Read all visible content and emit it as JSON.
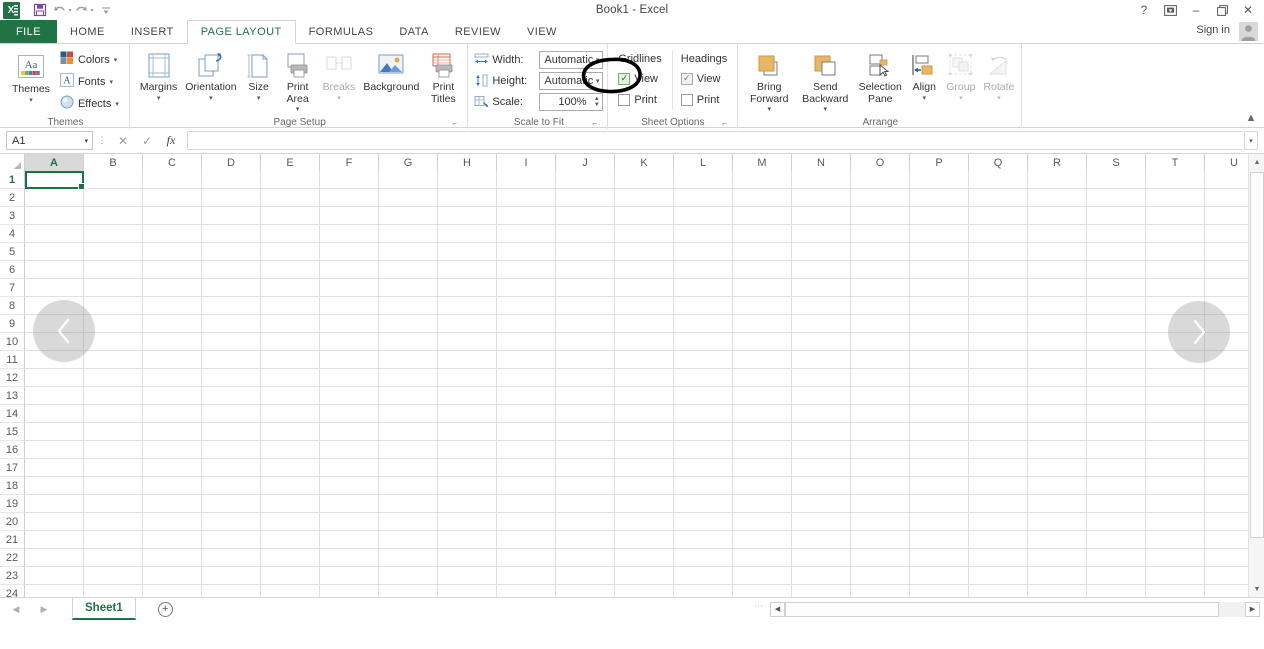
{
  "window": {
    "title": "Book1 - Excel",
    "app_icon": "excel-logo-icon",
    "controls": {
      "help": "?",
      "ribbon_display": "ribbon-display-options-icon",
      "minimize": "–",
      "restore": "❐",
      "close": "✕"
    },
    "quick_access": [
      {
        "name": "save-icon",
        "label": "Save"
      },
      {
        "name": "undo-icon",
        "label": "Undo"
      },
      {
        "name": "redo-icon",
        "label": "Redo"
      },
      {
        "name": "customize-qat-icon",
        "label": "Customize Quick Access Toolbar"
      }
    ]
  },
  "account": {
    "sign_in": "Sign in",
    "avatar": "user-avatar-icon"
  },
  "tabs": [
    {
      "label": "FILE",
      "active": false,
      "file": true
    },
    {
      "label": "HOME",
      "active": false
    },
    {
      "label": "INSERT",
      "active": false
    },
    {
      "label": "PAGE LAYOUT",
      "active": true
    },
    {
      "label": "FORMULAS",
      "active": false
    },
    {
      "label": "DATA",
      "active": false
    },
    {
      "label": "REVIEW",
      "active": false
    },
    {
      "label": "VIEW",
      "active": false
    }
  ],
  "ribbon": {
    "collapse_label": "▲",
    "groups": {
      "themes": {
        "label": "Themes",
        "main": {
          "label": "Themes",
          "caret": "▾",
          "icon": "themes-icon"
        },
        "items": [
          {
            "label": "Colors",
            "caret": "▾",
            "icon": "colors-icon"
          },
          {
            "label": "Fonts",
            "caret": "▾",
            "icon": "fonts-icon"
          },
          {
            "label": "Effects",
            "caret": "▾",
            "icon": "effects-icon"
          }
        ]
      },
      "page_setup": {
        "label": "Page Setup",
        "items": [
          {
            "label": "Margins",
            "caret": "▾",
            "icon": "margins-icon",
            "disabled": false
          },
          {
            "label": "Orientation",
            "caret": "▾",
            "icon": "orientation-icon",
            "disabled": false
          },
          {
            "label": "Size",
            "caret": "▾",
            "icon": "size-icon",
            "disabled": false
          },
          {
            "label": "Print Area",
            "caret": "▾",
            "icon": "print-area-icon",
            "disabled": false
          },
          {
            "label": "Breaks",
            "caret": "▾",
            "icon": "breaks-icon",
            "disabled": true
          },
          {
            "label": "Background",
            "caret": "",
            "icon": "background-icon",
            "disabled": false
          },
          {
            "label": "Print Titles",
            "caret": "",
            "icon": "print-titles-icon",
            "disabled": false
          }
        ]
      },
      "scale_to_fit": {
        "label": "Scale to Fit",
        "rows": [
          {
            "label": "Width:",
            "value": "Automatic",
            "icon": "width-icon",
            "type": "dropdown"
          },
          {
            "label": "Height:",
            "value": "Automatic",
            "icon": "height-icon",
            "type": "dropdown"
          },
          {
            "label": "Scale:",
            "value": "100%",
            "icon": "scale-icon",
            "type": "spinner"
          }
        ]
      },
      "sheet_options": {
        "label": "Sheet Options",
        "columns": [
          {
            "header": "Gridlines",
            "options": [
              {
                "label": "View",
                "checked": true,
                "highlight": true
              },
              {
                "label": "Print",
                "checked": false,
                "highlight": false
              }
            ]
          },
          {
            "header": "Headings",
            "options": [
              {
                "label": "View",
                "checked": true,
                "highlight": false
              },
              {
                "label": "Print",
                "checked": false,
                "highlight": false
              }
            ]
          }
        ]
      },
      "arrange": {
        "label": "Arrange",
        "items": [
          {
            "label": "Bring Forward",
            "caret": "▾",
            "icon": "bring-forward-icon",
            "disabled": false
          },
          {
            "label": "Send Backward",
            "caret": "▾",
            "icon": "send-backward-icon",
            "disabled": false
          },
          {
            "label": "Selection Pane",
            "caret": "",
            "icon": "selection-pane-icon",
            "disabled": false
          },
          {
            "label": "Align",
            "caret": "▾",
            "icon": "align-icon",
            "disabled": false
          },
          {
            "label": "Group",
            "caret": "▾",
            "icon": "group-icon",
            "disabled": true
          },
          {
            "label": "Rotate",
            "caret": "▾",
            "icon": "rotate-icon",
            "disabled": true
          }
        ]
      }
    }
  },
  "formula_bar": {
    "name_box": "A1",
    "name_box_caret": "▾",
    "cancel": "✕",
    "enter": "✓",
    "insert_function": "fx",
    "value": "",
    "expand": "▾"
  },
  "grid": {
    "columns": [
      "A",
      "B",
      "C",
      "D",
      "E",
      "F",
      "G",
      "H",
      "I",
      "J",
      "K",
      "L",
      "M",
      "N",
      "O",
      "P",
      "Q",
      "R",
      "S",
      "T",
      "U"
    ],
    "rows": [
      1,
      2,
      3,
      4,
      5,
      6,
      7,
      8,
      9,
      10,
      11,
      12,
      13,
      14,
      15,
      16,
      17,
      18,
      19,
      20,
      21,
      22,
      23,
      24
    ],
    "active_cell": "A1",
    "selected_column": "A",
    "selected_row": 1
  },
  "overlays": {
    "prev_arrow": "previous-navigation-arrow",
    "next_arrow": "next-navigation-arrow",
    "annotation": "hand-drawn-circle-around-gridlines-view"
  },
  "sheet_bar": {
    "prev": "◀",
    "next": "▶",
    "sheets": [
      {
        "label": "Sheet1",
        "active": true
      }
    ],
    "add_sheet": "+"
  },
  "scrollbars": {
    "v_up": "▲",
    "v_down": "▼",
    "h_left": "◀",
    "h_right": "▶"
  },
  "colors": {
    "accent_green": "#217346",
    "tab_active_text": "#217346",
    "annotation": "#000000",
    "grid_line": "#e0e0e0"
  }
}
